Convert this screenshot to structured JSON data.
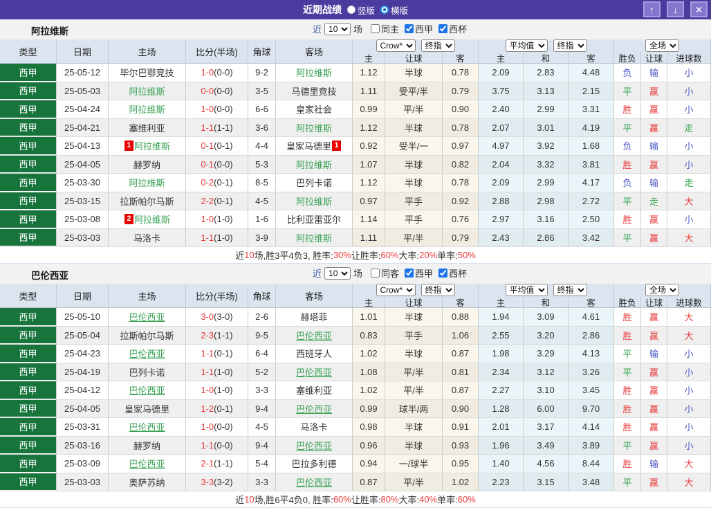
{
  "topbar": {
    "title": "近期战绩",
    "radios": [
      {
        "label": "竖版",
        "selected": false
      },
      {
        "label": "横版",
        "selected": true
      }
    ],
    "buttons": {
      "up": "↑",
      "down": "↓",
      "close": "✕"
    }
  },
  "colors": {
    "topbar_purple": "#4a3c9e",
    "league_green": "#17753c",
    "team_green": "#3aa254",
    "win_red": "#e83a3a",
    "draw_green": "#2fa34c",
    "lose_blue": "#4a56c6",
    "badge_red": "#e60000",
    "header_bg": "#dbe4ef",
    "handicap_col_bg": "#fbf6ec",
    "europe_col_bg": "#eaf5f9"
  },
  "header": {
    "left": [
      "类型",
      "日期",
      "主场",
      "比分(半场)",
      "角球",
      "客场"
    ],
    "selects": [
      "Crow*",
      "终指",
      "平均值",
      "终指",
      "全场"
    ],
    "sub": [
      "主",
      "让球",
      "客",
      "主",
      "和",
      "客",
      "胜负",
      "让球",
      "进球数"
    ]
  },
  "sections": [
    {
      "team": "阿拉维斯",
      "team_underline": false,
      "filter": {
        "near_label": "近",
        "count": "10",
        "games_label": "场",
        "checkboxes": [
          {
            "label": "同主",
            "checked": false
          },
          {
            "label": "西甲",
            "checked": true
          },
          {
            "label": "西杯",
            "checked": true
          }
        ]
      },
      "rows": [
        {
          "league": "西甲",
          "date": "25-05-12",
          "home": {
            "name": "毕尔巴鄂竞技",
            "team": false
          },
          "score": "1-0",
          "half": "(0-0)",
          "corner": "9-2",
          "away": {
            "name": "阿拉维斯",
            "team": true
          },
          "let": [
            "1.12",
            "半球",
            "0.78"
          ],
          "euro": [
            "2.09",
            "2.83",
            "4.48"
          ],
          "results": [
            {
              "text": "负",
              "tone": "lose"
            },
            {
              "text": "输",
              "tone": "lose"
            },
            {
              "text": "小",
              "tone": "lose"
            }
          ]
        },
        {
          "league": "西甲",
          "date": "25-05-03",
          "home": {
            "name": "阿拉维斯",
            "team": true
          },
          "score": "0-0",
          "half": "(0-0)",
          "corner": "3-5",
          "away": {
            "name": "马德里竞技",
            "team": false
          },
          "let": [
            "1.11",
            "受平/半",
            "0.79"
          ],
          "euro": [
            "3.75",
            "3.13",
            "2.15"
          ],
          "results": [
            {
              "text": "平",
              "tone": "draw"
            },
            {
              "text": "赢",
              "tone": "win"
            },
            {
              "text": "小",
              "tone": "lose"
            }
          ]
        },
        {
          "league": "西甲",
          "date": "25-04-24",
          "home": {
            "name": "阿拉维斯",
            "team": true
          },
          "score": "1-0",
          "half": "(0-0)",
          "corner": "6-6",
          "away": {
            "name": "皇家社会",
            "team": false
          },
          "let": [
            "0.99",
            "平/半",
            "0.90"
          ],
          "euro": [
            "2.40",
            "2.99",
            "3.31"
          ],
          "results": [
            {
              "text": "胜",
              "tone": "win"
            },
            {
              "text": "赢",
              "tone": "win"
            },
            {
              "text": "小",
              "tone": "lose"
            }
          ]
        },
        {
          "league": "西甲",
          "date": "25-04-21",
          "home": {
            "name": "塞维利亚",
            "team": false
          },
          "score": "1-1",
          "half": "(1-1)",
          "corner": "3-6",
          "away": {
            "name": "阿拉维斯",
            "team": true
          },
          "let": [
            "1.12",
            "半球",
            "0.78"
          ],
          "euro": [
            "2.07",
            "3.01",
            "4.19"
          ],
          "results": [
            {
              "text": "平",
              "tone": "draw"
            },
            {
              "text": "赢",
              "tone": "win"
            },
            {
              "text": "走",
              "tone": "draw"
            }
          ]
        },
        {
          "league": "西甲",
          "date": "25-04-13",
          "home": {
            "name": "阿拉维斯",
            "team": true,
            "badge": "1"
          },
          "score": "0-1",
          "half": "(0-1)",
          "corner": "4-4",
          "away": {
            "name": "皇家马德里",
            "team": false,
            "badge": "1"
          },
          "let": [
            "0.92",
            "受半/一",
            "0.97"
          ],
          "euro": [
            "4.97",
            "3.92",
            "1.68"
          ],
          "results": [
            {
              "text": "负",
              "tone": "lose"
            },
            {
              "text": "输",
              "tone": "lose"
            },
            {
              "text": "小",
              "tone": "lose"
            }
          ]
        },
        {
          "league": "西甲",
          "date": "25-04-05",
          "home": {
            "name": "赫罗纳",
            "team": false
          },
          "score": "0-1",
          "half": "(0-0)",
          "corner": "5-3",
          "away": {
            "name": "阿拉维斯",
            "team": true
          },
          "let": [
            "1.07",
            "半球",
            "0.82"
          ],
          "euro": [
            "2.04",
            "3.32",
            "3.81"
          ],
          "results": [
            {
              "text": "胜",
              "tone": "win"
            },
            {
              "text": "赢",
              "tone": "win"
            },
            {
              "text": "小",
              "tone": "lose"
            }
          ]
        },
        {
          "league": "西甲",
          "date": "25-03-30",
          "home": {
            "name": "阿拉维斯",
            "team": true
          },
          "score": "0-2",
          "half": "(0-1)",
          "corner": "8-5",
          "away": {
            "name": "巴列卡诺",
            "team": false
          },
          "let": [
            "1.12",
            "半球",
            "0.78"
          ],
          "euro": [
            "2.09",
            "2.99",
            "4.17"
          ],
          "results": [
            {
              "text": "负",
              "tone": "lose"
            },
            {
              "text": "输",
              "tone": "lose"
            },
            {
              "text": "走",
              "tone": "draw"
            }
          ]
        },
        {
          "league": "西甲",
          "date": "25-03-15",
          "home": {
            "name": "拉斯帕尔马斯",
            "team": false
          },
          "score": "2-2",
          "half": "(0-1)",
          "corner": "4-5",
          "away": {
            "name": "阿拉维斯",
            "team": true
          },
          "let": [
            "0.97",
            "平手",
            "0.92"
          ],
          "euro": [
            "2.88",
            "2.98",
            "2.72"
          ],
          "results": [
            {
              "text": "平",
              "tone": "draw"
            },
            {
              "text": "走",
              "tone": "draw"
            },
            {
              "text": "大",
              "tone": "win"
            }
          ]
        },
        {
          "league": "西甲",
          "date": "25-03-08",
          "home": {
            "name": "阿拉维斯",
            "team": true,
            "badge": "2"
          },
          "score": "1-0",
          "half": "(1-0)",
          "corner": "1-6",
          "away": {
            "name": "比利亚雷亚尔",
            "team": false
          },
          "let": [
            "1.14",
            "平手",
            "0.76"
          ],
          "euro": [
            "2.97",
            "3.16",
            "2.50"
          ],
          "results": [
            {
              "text": "胜",
              "tone": "win"
            },
            {
              "text": "赢",
              "tone": "win"
            },
            {
              "text": "小",
              "tone": "lose"
            }
          ]
        },
        {
          "league": "西甲",
          "date": "25-03-03",
          "home": {
            "name": "马洛卡",
            "team": false
          },
          "score": "1-1",
          "half": "(1-0)",
          "corner": "3-9",
          "away": {
            "name": "阿拉维斯",
            "team": true
          },
          "let": [
            "1.11",
            "平/半",
            "0.79"
          ],
          "euro": [
            "2.43",
            "2.86",
            "3.42"
          ],
          "results": [
            {
              "text": "平",
              "tone": "draw"
            },
            {
              "text": "赢",
              "tone": "win"
            },
            {
              "text": "大",
              "tone": "win"
            }
          ]
        }
      ],
      "summary": [
        {
          "text": "近"
        },
        {
          "text": "10",
          "red": true
        },
        {
          "text": "场,胜3平4负3, 胜率:"
        },
        {
          "text": "30%",
          "red": true
        },
        {
          "text": " 让胜率:"
        },
        {
          "text": "60%",
          "red": true
        },
        {
          "text": " 大率:"
        },
        {
          "text": "20%",
          "red": true
        },
        {
          "text": " 单率:"
        },
        {
          "text": "50%",
          "red": true
        }
      ]
    },
    {
      "team": "巴伦西亚",
      "team_underline": true,
      "filter": {
        "near_label": "近",
        "count": "10",
        "games_label": "场",
        "checkboxes": [
          {
            "label": "同客",
            "checked": false
          },
          {
            "label": "西甲",
            "checked": true
          },
          {
            "label": "西杯",
            "checked": true
          }
        ]
      },
      "rows": [
        {
          "league": "西甲",
          "date": "25-05-10",
          "home": {
            "name": "巴伦西亚",
            "team": true
          },
          "score": "3-0",
          "half": "(3-0)",
          "corner": "2-6",
          "away": {
            "name": "赫塔菲",
            "team": false
          },
          "let": [
            "1.01",
            "半球",
            "0.88"
          ],
          "euro": [
            "1.94",
            "3.09",
            "4.61"
          ],
          "results": [
            {
              "text": "胜",
              "tone": "win"
            },
            {
              "text": "赢",
              "tone": "win"
            },
            {
              "text": "大",
              "tone": "win"
            }
          ]
        },
        {
          "league": "西甲",
          "date": "25-05-04",
          "home": {
            "name": "拉斯帕尔马斯",
            "team": false
          },
          "score": "2-3",
          "half": "(1-1)",
          "corner": "9-5",
          "away": {
            "name": "巴伦西亚",
            "team": true
          },
          "let": [
            "0.83",
            "平手",
            "1.06"
          ],
          "euro": [
            "2.55",
            "3.20",
            "2.86"
          ],
          "results": [
            {
              "text": "胜",
              "tone": "win"
            },
            {
              "text": "赢",
              "tone": "win"
            },
            {
              "text": "大",
              "tone": "win"
            }
          ]
        },
        {
          "league": "西甲",
          "date": "25-04-23",
          "home": {
            "name": "巴伦西亚",
            "team": true
          },
          "score": "1-1",
          "half": "(0-1)",
          "corner": "6-4",
          "away": {
            "name": "西班牙人",
            "team": false
          },
          "let": [
            "1.02",
            "半球",
            "0.87"
          ],
          "euro": [
            "1.98",
            "3.29",
            "4.13"
          ],
          "results": [
            {
              "text": "平",
              "tone": "draw"
            },
            {
              "text": "输",
              "tone": "lose"
            },
            {
              "text": "小",
              "tone": "lose"
            }
          ]
        },
        {
          "league": "西甲",
          "date": "25-04-19",
          "home": {
            "name": "巴列卡诺",
            "team": false
          },
          "score": "1-1",
          "half": "(1-0)",
          "corner": "5-2",
          "away": {
            "name": "巴伦西亚",
            "team": true
          },
          "let": [
            "1.08",
            "平/半",
            "0.81"
          ],
          "euro": [
            "2.34",
            "3.12",
            "3.26"
          ],
          "results": [
            {
              "text": "平",
              "tone": "draw"
            },
            {
              "text": "赢",
              "tone": "win"
            },
            {
              "text": "小",
              "tone": "lose"
            }
          ]
        },
        {
          "league": "西甲",
          "date": "25-04-12",
          "home": {
            "name": "巴伦西亚",
            "team": true
          },
          "score": "1-0",
          "half": "(1-0)",
          "corner": "3-3",
          "away": {
            "name": "塞维利亚",
            "team": false
          },
          "let": [
            "1.02",
            "平/半",
            "0.87"
          ],
          "euro": [
            "2.27",
            "3.10",
            "3.45"
          ],
          "results": [
            {
              "text": "胜",
              "tone": "win"
            },
            {
              "text": "赢",
              "tone": "win"
            },
            {
              "text": "小",
              "tone": "lose"
            }
          ]
        },
        {
          "league": "西甲",
          "date": "25-04-05",
          "home": {
            "name": "皇家马德里",
            "team": false
          },
          "score": "1-2",
          "half": "(0-1)",
          "corner": "9-4",
          "away": {
            "name": "巴伦西亚",
            "team": true
          },
          "let": [
            "0.99",
            "球半/两",
            "0.90"
          ],
          "euro": [
            "1.28",
            "6.00",
            "9.70"
          ],
          "results": [
            {
              "text": "胜",
              "tone": "win"
            },
            {
              "text": "赢",
              "tone": "win"
            },
            {
              "text": "小",
              "tone": "lose"
            }
          ]
        },
        {
          "league": "西甲",
          "date": "25-03-31",
          "home": {
            "name": "巴伦西亚",
            "team": true
          },
          "score": "1-0",
          "half": "(0-0)",
          "corner": "4-5",
          "away": {
            "name": "马洛卡",
            "team": false
          },
          "let": [
            "0.98",
            "半球",
            "0.91"
          ],
          "euro": [
            "2.01",
            "3.17",
            "4.14"
          ],
          "results": [
            {
              "text": "胜",
              "tone": "win"
            },
            {
              "text": "赢",
              "tone": "win"
            },
            {
              "text": "小",
              "tone": "lose"
            }
          ]
        },
        {
          "league": "西甲",
          "date": "25-03-16",
          "home": {
            "name": "赫罗纳",
            "team": false
          },
          "score": "1-1",
          "half": "(0-0)",
          "corner": "9-4",
          "away": {
            "name": "巴伦西亚",
            "team": true
          },
          "let": [
            "0.96",
            "半球",
            "0.93"
          ],
          "euro": [
            "1.96",
            "3.49",
            "3.89"
          ],
          "results": [
            {
              "text": "平",
              "tone": "draw"
            },
            {
              "text": "赢",
              "tone": "win"
            },
            {
              "text": "小",
              "tone": "lose"
            }
          ]
        },
        {
          "league": "西甲",
          "date": "25-03-09",
          "home": {
            "name": "巴伦西亚",
            "team": true
          },
          "score": "2-1",
          "half": "(1-1)",
          "corner": "5-4",
          "away": {
            "name": "巴拉多利德",
            "team": false
          },
          "let": [
            "0.94",
            "一/球半",
            "0.95"
          ],
          "euro": [
            "1.40",
            "4.56",
            "8.44"
          ],
          "results": [
            {
              "text": "胜",
              "tone": "win"
            },
            {
              "text": "输",
              "tone": "lose"
            },
            {
              "text": "大",
              "tone": "win"
            }
          ]
        },
        {
          "league": "西甲",
          "date": "25-03-03",
          "home": {
            "name": "奥萨苏纳",
            "team": false
          },
          "score": "3-3",
          "half": "(3-2)",
          "corner": "3-3",
          "away": {
            "name": "巴伦西亚",
            "team": true
          },
          "let": [
            "0.87",
            "平/半",
            "1.02"
          ],
          "euro": [
            "2.23",
            "3.15",
            "3.48"
          ],
          "results": [
            {
              "text": "平",
              "tone": "draw"
            },
            {
              "text": "赢",
              "tone": "win"
            },
            {
              "text": "大",
              "tone": "win"
            }
          ]
        }
      ],
      "summary": [
        {
          "text": "近"
        },
        {
          "text": "10",
          "red": true
        },
        {
          "text": "场,胜6平4负0, 胜率:"
        },
        {
          "text": "60%",
          "red": true
        },
        {
          "text": " 让胜率:"
        },
        {
          "text": "80%",
          "red": true
        },
        {
          "text": " 大率:"
        },
        {
          "text": "40%",
          "red": true
        },
        {
          "text": " 单率:"
        },
        {
          "text": "60%",
          "red": true
        }
      ]
    }
  ]
}
